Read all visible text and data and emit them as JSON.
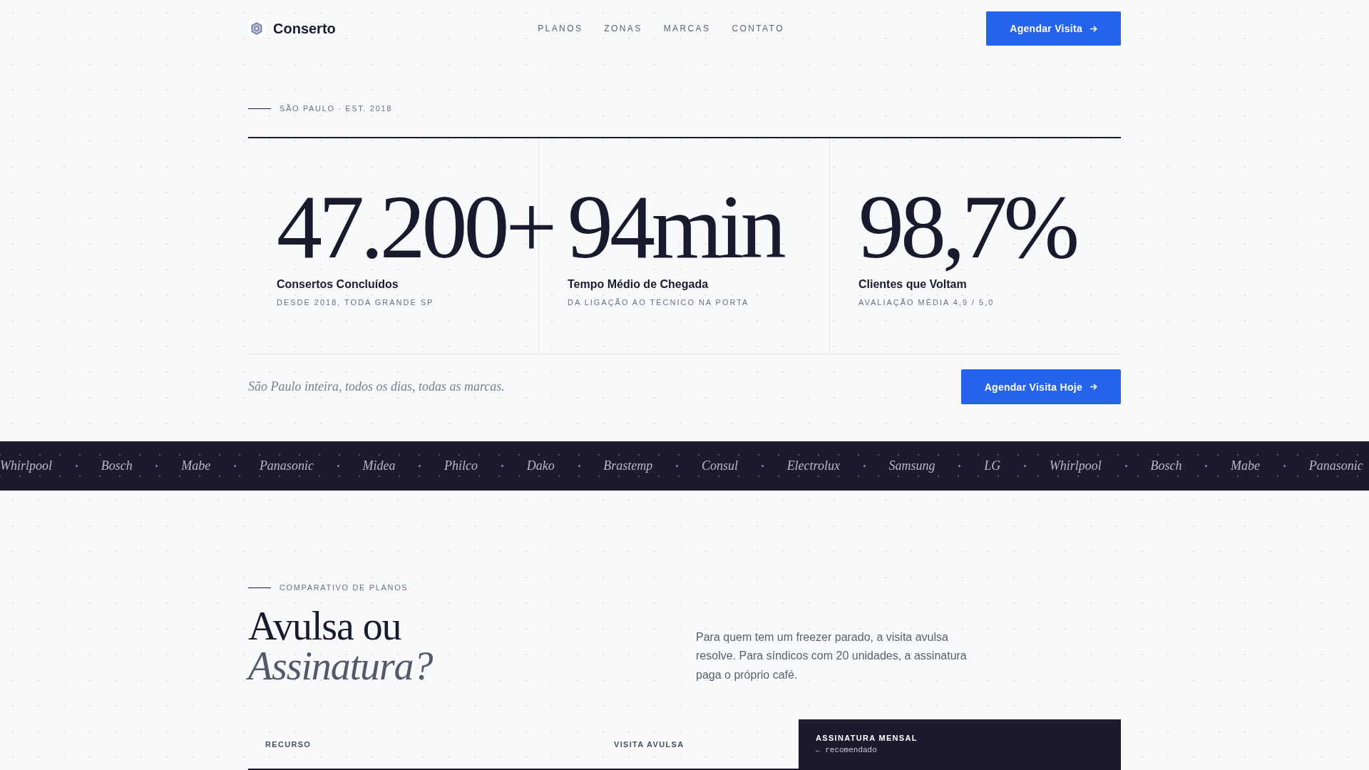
{
  "header": {
    "logo": "Conserto",
    "nav": [
      {
        "label": "PLANOS"
      },
      {
        "label": "ZONAS"
      },
      {
        "label": "MARCAS"
      },
      {
        "label": "CONTATO"
      }
    ],
    "cta": "Agendar Visita"
  },
  "hero": {
    "eyebrow": "SÃO PAULO · EST. 2018",
    "stats": [
      {
        "value": "47.200+",
        "label": "Consertos Concluídos",
        "note": "DESDE 2018, TODA GRANDE SP"
      },
      {
        "value": "94min",
        "label": "Tempo Médio de Chegada",
        "note": "DA LIGAÇÃO AO TÉCNICO NA PORTA"
      },
      {
        "value": "98,7%",
        "label": "Clientes que Voltam",
        "note": "AVALIAÇÃO MÉDIA 4,9 / 5,0"
      }
    ],
    "tagline": "São Paulo inteira, todos os dias, todas as marcas.",
    "cta": "Agendar Visita Hoje"
  },
  "brand_marquee": {
    "brands": [
      "Whirlpool",
      "Bosch",
      "Mabe",
      "Panasonic",
      "Midea",
      "Philco",
      "Dako",
      "Brastemp",
      "Consul",
      "Electrolux",
      "Samsung",
      "LG",
      "Whirlpool",
      "Bosch",
      "Mabe",
      "Panasonic"
    ]
  },
  "plans": {
    "eyebrow": "COMPARATIVO DE PLANOS",
    "title": "Avulsa ou *Assinatura?*",
    "intro": "Para quem tem um freezer parado, a visita avulsa resolve. Para síndicos com 20 unidades, a assinatura paga o próprio café.",
    "table": {
      "columns": [
        {
          "label": "RECURSO",
          "highlighted": false
        },
        {
          "label": "VISITA AVULSA",
          "highlighted": false
        },
        {
          "label": "ASSINATURA MENSAL",
          "highlighted": true,
          "note": "← recomendado"
        }
      ]
    }
  }
}
